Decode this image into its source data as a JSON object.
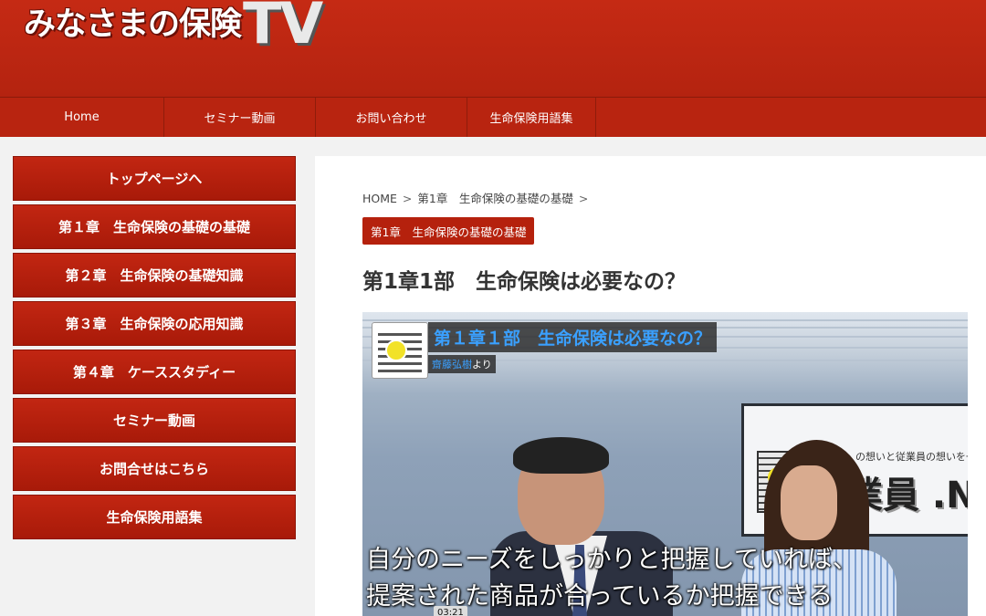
{
  "header": {
    "logo_text": "みなさまの保険",
    "logo_tv": "TV"
  },
  "nav": {
    "items": [
      {
        "label": "Home"
      },
      {
        "label": "セミナー動画"
      },
      {
        "label": "お問い合わせ"
      },
      {
        "label": "生命保険用語集"
      }
    ]
  },
  "sidebar": {
    "items": [
      {
        "label": "トップページへ"
      },
      {
        "label": "第１章　生命保険の基礎の基礎"
      },
      {
        "label": "第２章　生命保険の基礎知識"
      },
      {
        "label": "第３章　生命保険の応用知識"
      },
      {
        "label": "第４章　ケーススタディー"
      },
      {
        "label": "セミナー動画"
      },
      {
        "label": "お問合せはこちら"
      },
      {
        "label": "生命保険用語集"
      }
    ]
  },
  "breadcrumb": {
    "home": "HOME",
    "category": "第1章　生命保険の基礎の基礎",
    "separator": ">"
  },
  "category_badge": "第1章　生命保険の基礎の基礎",
  "page_title": "第1章1部　生命保険は必要なの？",
  "video": {
    "title": "第１章１部　生命保険は必要なの？",
    "author": "齋藤弘樹",
    "author_suffix": "より",
    "screen_text": "の想いと従業員の想いを一",
    "screen_brand": "業員 .NE",
    "subtitle_line1": "自分のニーズをしっかりと把握していれば、",
    "subtitle_line2": "提案された商品が合っているか把握できる",
    "time": "03:21"
  },
  "colors": {
    "header_red": "#b42310",
    "button_red": "#b5210d",
    "video_title_blue": "#3aa0ff"
  }
}
